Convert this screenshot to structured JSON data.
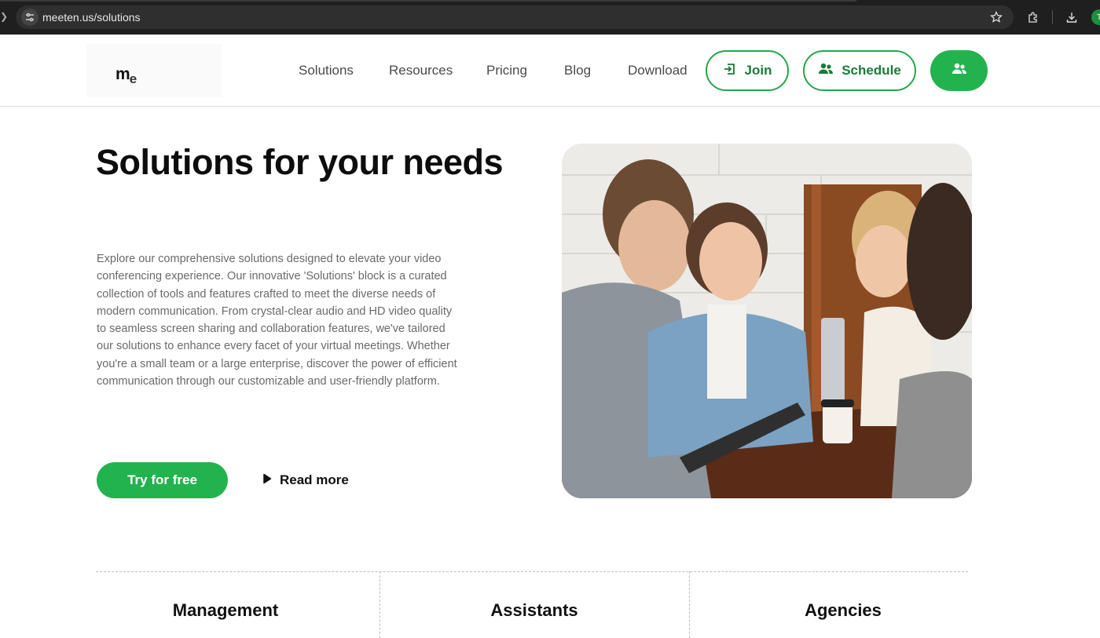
{
  "browser": {
    "url": "meeten.us/solutions",
    "profile_initial": "T"
  },
  "header": {
    "logo": {
      "main": "m",
      "sub": "e"
    },
    "nav": [
      "Solutions",
      "Resources",
      "Pricing",
      "Blog",
      "Download"
    ],
    "join_label": "Join",
    "schedule_label": "Schedule"
  },
  "hero": {
    "title": "Solutions for your needs",
    "body": "Explore our comprehensive solutions designed to elevate your video conferencing experience. Our innovative 'Solutions' block is a curated collection of tools and features crafted to meet the diverse needs of modern communication. From crystal-clear audio and HD video quality to seamless screen sharing and collaboration features, we've tailored our solutions to enhance every facet of your virtual meetings. Whether you're a small team or a large enterprise, discover the power of efficient communication through our customizable and user-friendly platform.",
    "cta_primary": "Try for free",
    "cta_secondary": "Read more"
  },
  "categories": [
    "Management",
    "Assistants",
    "Agencies"
  ],
  "colors": {
    "accent": "#22b34e",
    "accent_dark": "#1a7a36",
    "browser_bar": "#1f1f1f"
  },
  "icons": {
    "join": "join-icon",
    "schedule": "users-icon",
    "play": "play-icon"
  }
}
